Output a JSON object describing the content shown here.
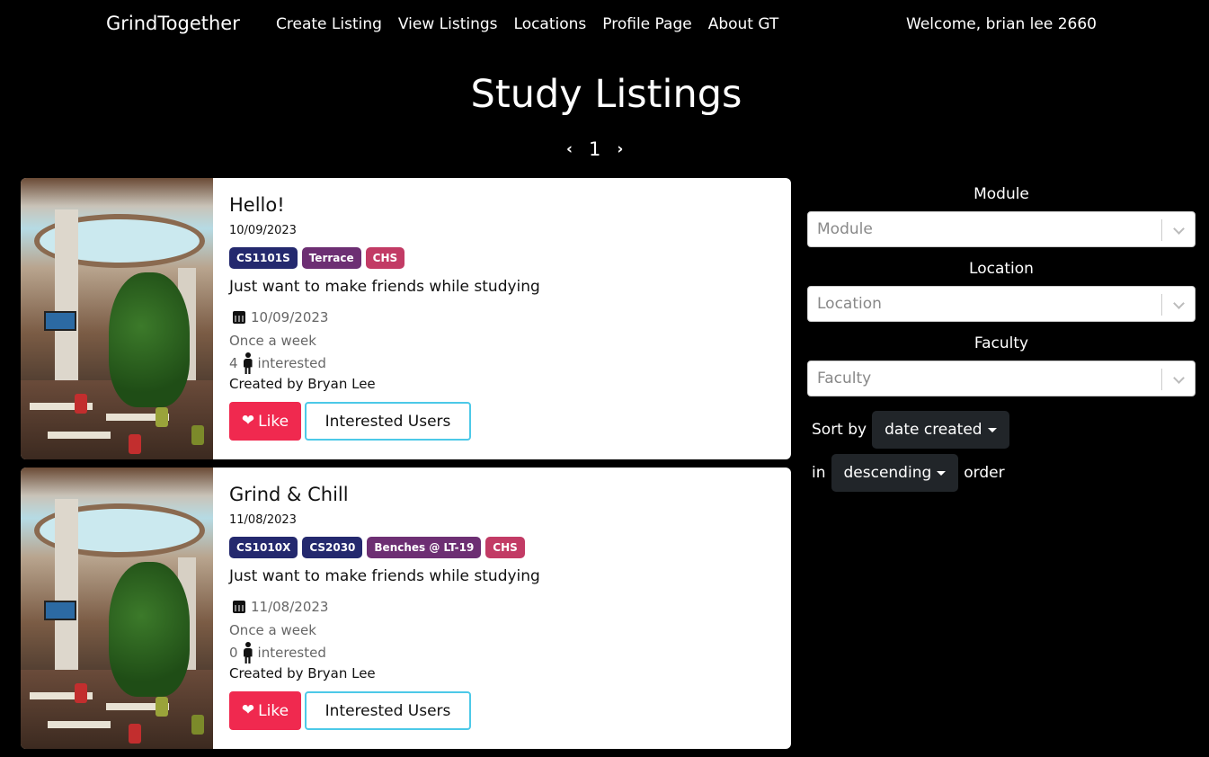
{
  "nav": {
    "brand": "GrindTogether",
    "links": [
      "Create Listing",
      "View Listings",
      "Locations",
      "Profile Page",
      "About GT"
    ],
    "welcome": "Welcome, brian lee 2660"
  },
  "page": {
    "title": "Study Listings",
    "pagination": {
      "prev": "‹",
      "current": "1",
      "next": "›"
    }
  },
  "listings": [
    {
      "title": "Hello!",
      "date": "10/09/2023",
      "tags": [
        {
          "label": "CS1101S",
          "kind": "module"
        },
        {
          "label": "Terrace",
          "kind": "location"
        },
        {
          "label": "CHS",
          "kind": "faculty"
        }
      ],
      "description": "Just want to make friends while studying",
      "session_date": "10/09/2023",
      "frequency": "Once a week",
      "interested_count": "4",
      "interested_label": "interested",
      "creator": "Created by Bryan Lee",
      "like_label": "Like",
      "interested_users_label": "Interested Users"
    },
    {
      "title": "Grind & Chill",
      "date": "11/08/2023",
      "tags": [
        {
          "label": "CS1010X",
          "kind": "module"
        },
        {
          "label": "CS2030",
          "kind": "module"
        },
        {
          "label": "Benches @ LT-19",
          "kind": "location"
        },
        {
          "label": "CHS",
          "kind": "faculty"
        }
      ],
      "description": "Just want to make friends while studying",
      "session_date": "11/08/2023",
      "frequency": "Once a week",
      "interested_count": "0",
      "interested_label": "interested",
      "creator": "Created by Bryan Lee",
      "like_label": "Like",
      "interested_users_label": "Interested Users"
    }
  ],
  "filters": {
    "module": {
      "label": "Module",
      "placeholder": "Module"
    },
    "location": {
      "label": "Location",
      "placeholder": "Location"
    },
    "faculty": {
      "label": "Faculty",
      "placeholder": "Faculty"
    },
    "sort": {
      "prefix": "Sort by",
      "field": "date created",
      "in_label": "in",
      "direction": "descending",
      "suffix": "order"
    }
  },
  "colors": {
    "module_tag": "#24296e",
    "location_tag": "#6d2f73",
    "faculty_tag": "#c23b65",
    "like_button": "#f0294f",
    "interested_border": "#4cc9e8"
  }
}
